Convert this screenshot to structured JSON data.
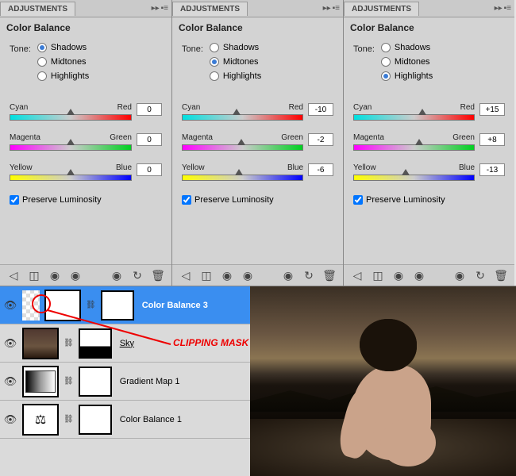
{
  "panels": [
    {
      "tab": "ADJUSTMENTS",
      "title": "Color Balance",
      "toneLabel": "Tone:",
      "shadows": "Shadows",
      "midtones": "Midtones",
      "highlights": "Highlights",
      "selected": "shadows",
      "s1": {
        "l": "Cyan",
        "r": "Red",
        "v": "0",
        "pos": 50
      },
      "s2": {
        "l": "Magenta",
        "r": "Green",
        "v": "0",
        "pos": 50
      },
      "s3": {
        "l": "Yellow",
        "r": "Blue",
        "v": "0",
        "pos": 50
      },
      "preserve": "Preserve Luminosity"
    },
    {
      "tab": "ADJUSTMENTS",
      "title": "Color Balance",
      "toneLabel": "Tone:",
      "shadows": "Shadows",
      "midtones": "Midtones",
      "highlights": "Highlights",
      "selected": "midtones",
      "s1": {
        "l": "Cyan",
        "r": "Red",
        "v": "-10",
        "pos": 45
      },
      "s2": {
        "l": "Magenta",
        "r": "Green",
        "v": "-2",
        "pos": 49
      },
      "s3": {
        "l": "Yellow",
        "r": "Blue",
        "v": "-6",
        "pos": 47
      },
      "preserve": "Preserve Luminosity"
    },
    {
      "tab": "ADJUSTMENTS",
      "title": "Color Balance",
      "toneLabel": "Tone:",
      "shadows": "Shadows",
      "midtones": "Midtones",
      "highlights": "Highlights",
      "selected": "highlights",
      "s1": {
        "l": "Cyan",
        "r": "Red",
        "v": "+15",
        "pos": 57
      },
      "s2": {
        "l": "Magenta",
        "r": "Green",
        "v": "+8",
        "pos": 54
      },
      "s3": {
        "l": "Yellow",
        "r": "Blue",
        "v": "-13",
        "pos": 43
      },
      "preserve": "Preserve Luminosity"
    }
  ],
  "layers": [
    {
      "name": "Color Balance 3",
      "sel": true,
      "icon": "balance"
    },
    {
      "name": "Sky",
      "sel": false,
      "icon": "sky"
    },
    {
      "name": "Gradient Map 1",
      "sel": false,
      "icon": "gradient"
    },
    {
      "name": "Color Balance 1",
      "sel": false,
      "icon": "balance"
    }
  ],
  "annotation": "CLIPPING MASK"
}
